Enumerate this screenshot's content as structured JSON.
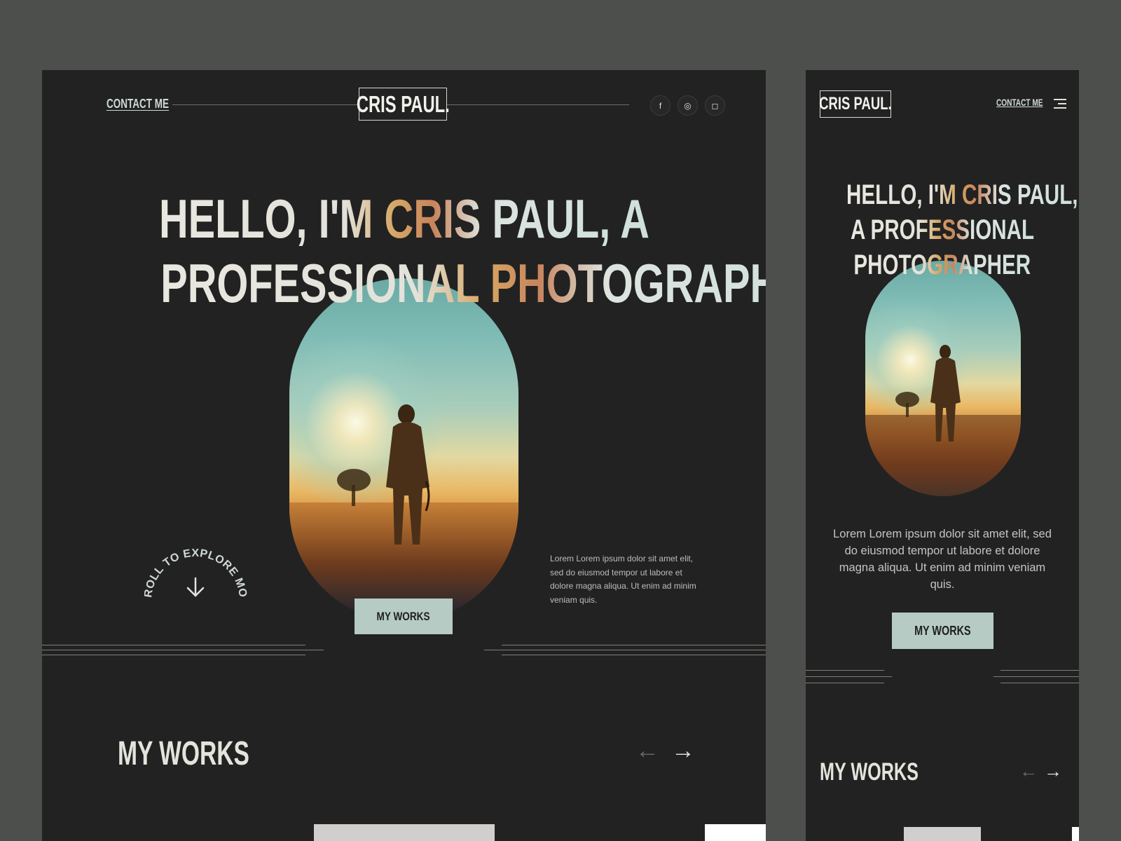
{
  "desktop": {
    "nav": {
      "contact_label": "CONTACT ME",
      "logo": "CRIS PAUL."
    },
    "social": [
      {
        "icon": "facebook-icon",
        "glyph": "f"
      },
      {
        "icon": "dribbble-icon",
        "glyph": "◎"
      },
      {
        "icon": "instagram-icon",
        "glyph": "◻"
      }
    ],
    "hero": {
      "headline_line1": "HELLO, I'M CRIS PAUL, A",
      "headline_line2": "PROFESSIONAL PHOTOGRAPHER",
      "scroll_text": "SCROLL TO EXPLORE MORE",
      "description": "Lorem Lorem ipsum dolor sit amet elit, sed do eiusmod tempor ut labore et dolore magna aliqua. Ut enim ad minim veniam quis.",
      "cta": "MY WORKS"
    },
    "works": {
      "title": "MY WORKS",
      "prev": "←",
      "next": "→"
    }
  },
  "mobile": {
    "nav": {
      "logo": "CRIS PAUL.",
      "contact_label": "CONTACT ME",
      "menu_icon": "hamburger-menu-icon"
    },
    "hero": {
      "headline_line1": "HELLO, I'M CRIS PAUL,",
      "headline_line2": "A PROFESSIONAL",
      "headline_line3": "PHOTOGRAPHER",
      "description": "Lorem Lorem ipsum dolor sit amet elit, sed do eiusmod tempor ut labore et dolore magna aliqua. Ut enim ad minim veniam quis.",
      "cta": "MY WORKS"
    },
    "works": {
      "title": "MY WORKS",
      "prev": "←",
      "next": "→"
    }
  },
  "colors": {
    "canvas": "#4d4f4c",
    "background": "#222222",
    "accent": "#b6cbc3",
    "text_light": "#e4e3dc",
    "gradient_warm": "#d6a664"
  }
}
